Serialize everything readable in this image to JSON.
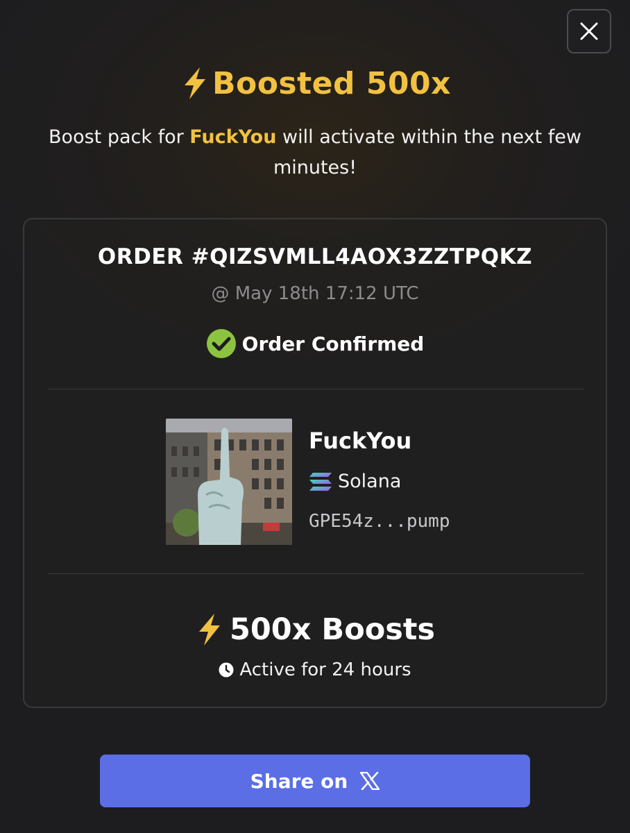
{
  "header": {
    "title": "Boosted 500x",
    "title_icon": "lightning-bolt-icon",
    "close_icon": "close-icon"
  },
  "subtitle": {
    "prefix": "Boost pack for ",
    "token": "FuckYou",
    "suffix": " will activate within the next few minutes!"
  },
  "order": {
    "id": "ORDER #QIZSVMLL4AOX3ZZTPQKZ",
    "time": "@ May 18th 17:12 UTC",
    "status": "Order Confirmed",
    "status_icon": "check-circle-icon"
  },
  "token": {
    "name": "FuckYou",
    "chain": "Solana",
    "chain_icon": "solana-logo-icon",
    "address": "GPE54z...pump",
    "image": "token-image"
  },
  "boost": {
    "label": "500x Boosts",
    "icon": "lightning-bolt-icon",
    "duration": "Active for 24 hours",
    "duration_icon": "clock-icon"
  },
  "share": {
    "label": "Share on",
    "icon": "x-logo-icon"
  },
  "colors": {
    "accent": "#f2c141",
    "button": "#5b6ee6",
    "success": "#8cc43f",
    "muted": "#8c8c8f"
  }
}
